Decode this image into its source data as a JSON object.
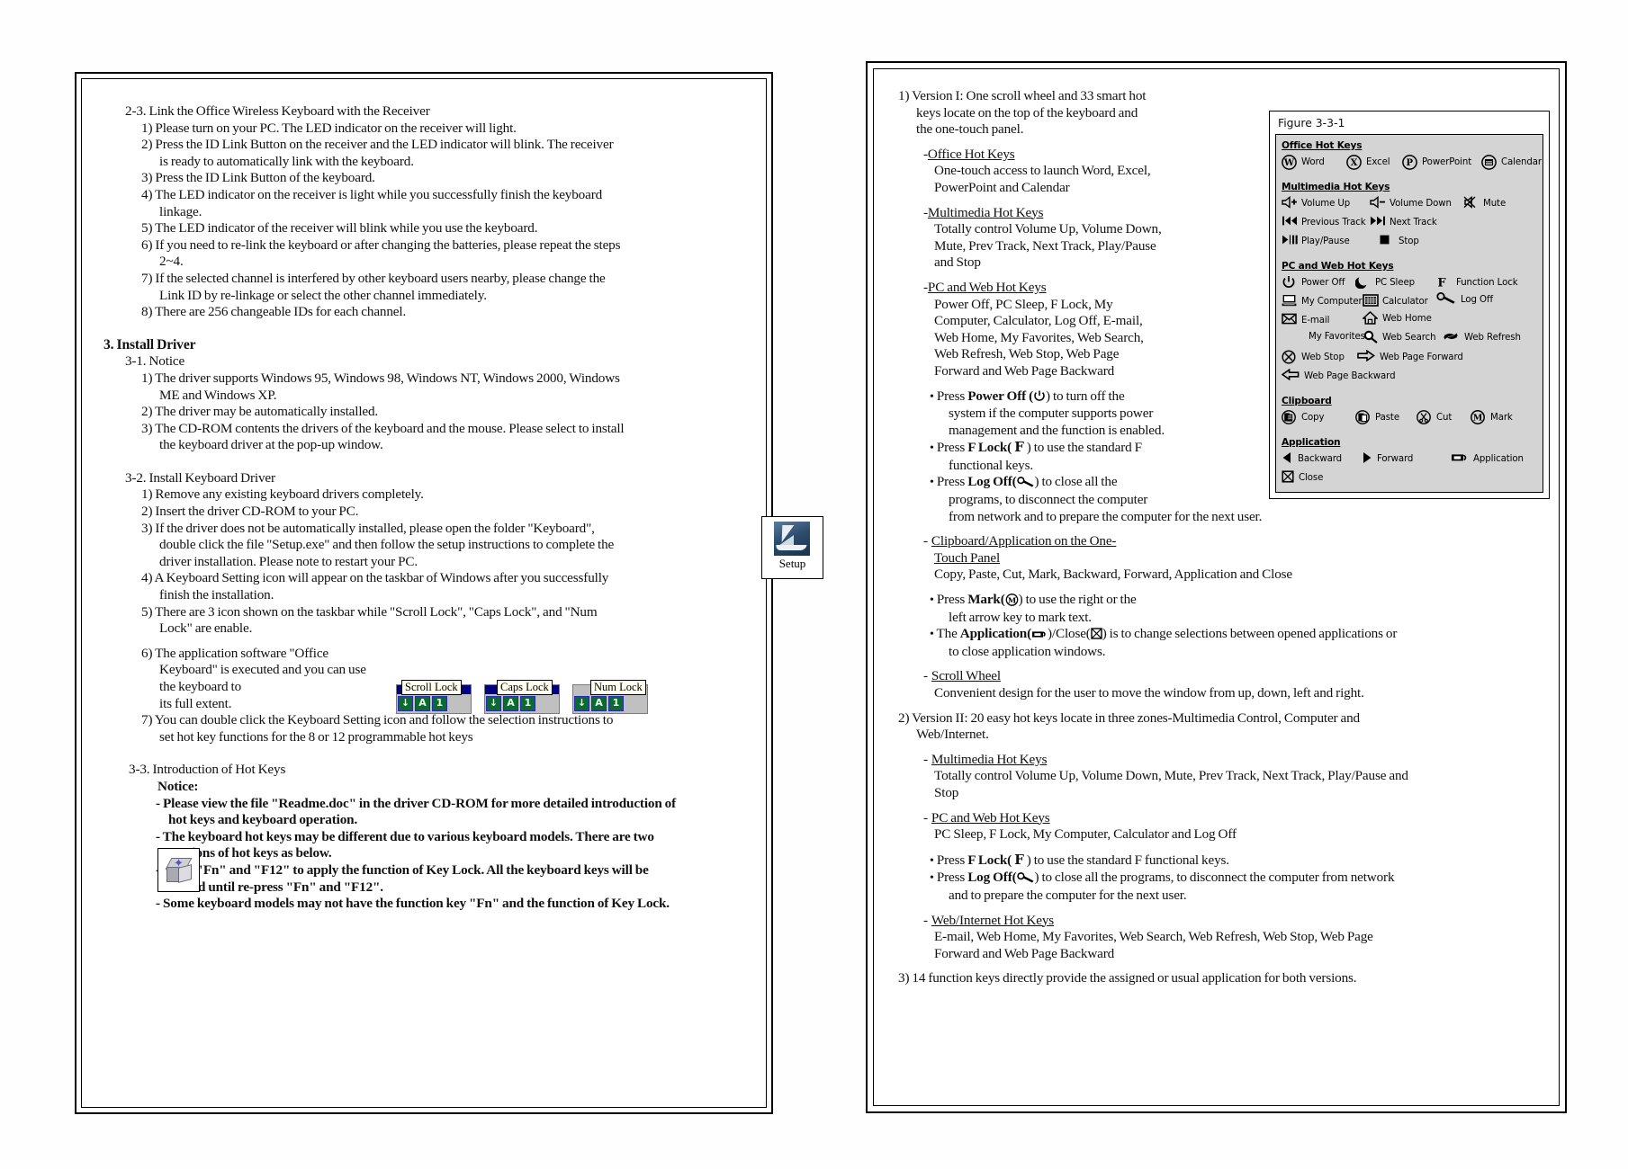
{
  "document": {
    "left_page": {
      "section_2_3": {
        "heading": "2-3. Link the Office Wireless Keyboard with the Receiver",
        "items": [
          "1) Please turn on your PC.  The LED indicator on the receiver will light.",
          "2) Press the ID Link Button on the receiver and the LED indicator will blink.  The receiver is ready to automatically link with the keyboard.",
          "3) Press the ID Link Button of the keyboard.",
          "4) The LED indicator on the receiver is light while you successfully finish the keyboard linkage.",
          "5) The LED indicator of the receiver will blink while you use the keyboard.",
          "6) If you need to re-link the keyboard or after changing the batteries, please repeat the steps 2~4.",
          "7) If the selected channel is interfered by other keyboard users nearby, please change the Link ID by re-linkage or select the other channel immediately.",
          "8) There are 256 changeable IDs for each channel."
        ],
        "item2_line1": "2) Press the ID Link Button on the receiver and the LED indicator will blink.  The receiver",
        "item2_line2": "is ready to automatically link with the keyboard.",
        "item4_line1": "4) The LED indicator on the receiver is light while you successfully finish the keyboard",
        "item4_line2": "linkage.",
        "item6_line1": "6) If you need to re-link the keyboard or after changing the batteries, please repeat the steps",
        "item6_line2": "2~4.",
        "item7_line1": "7) If the selected channel is interfered by other keyboard users nearby, please change the",
        "item7_line2": "Link ID by re-linkage or select the other channel immediately."
      },
      "section_3": {
        "heading": "3. Install Driver",
        "notice": {
          "heading": "3-1. Notice",
          "item1_line1": "1) The driver supports Windows 95, Windows 98, Windows NT, Windows 2000, Windows",
          "item1_line2": "ME and Windows XP.",
          "item2": "2) The driver may be automatically installed.",
          "item3_line1": "3) The CD-ROM contents the drivers of the keyboard and the mouse.  Please select to install",
          "item3_line2": "the keyboard driver at the pop-up window."
        },
        "install_keyboard_driver": {
          "heading": "3-2. Install Keyboard Driver",
          "item1": "1) Remove any existing keyboard drivers completely.",
          "item2": "2) Insert the driver CD-ROM to your PC.",
          "item3_line1": "3) If the driver does not be automatically installed, please open the folder \"Keyboard\",",
          "item3_line2": "double click the file \"Setup.exe\" and then follow the setup instructions to complete the",
          "item3_line3": "driver installation.  Please note to restart your PC.",
          "item4_line1": "4) A Keyboard Setting icon will appear on the taskbar of Windows after you successfully",
          "item4_line2": "finish the installation.",
          "item5_line1": "5) There are 3 icon shown on the taskbar while \"Scroll  Lock\", \"Caps Lock\", and \"Num",
          "item5_line2": "Lock\" are enable.",
          "item6_line1": "6) The application software \"Office",
          "item6_line2": "Keyboard\" is executed and you can use",
          "item6_line3": "the keyboard to",
          "item6_line4": " its full extent.",
          "item7_line1": "7) You can double click the Keyboard Setting icon and follow the selection instructions to",
          "item7_line2": "set hot key functions for the 8 or 12 programmable hot keys"
        },
        "intro_hot_keys": {
          "heading": "3-3. Introduction of Hot Keys",
          "notice_label": "Notice:",
          "notes": [
            "- Please view the file \"Readme.doc\" in the driver CD-ROM for more detailed introduction of",
            "hot keys and keyboard operation.",
            "- The keyboard hot keys may be different due to various keyboard models.  There are two",
            "versions of hot keys as below.",
            "- Press \"Fn\" and \"F12\" to apply the function of Key Lock.  All the keyboard keys will be",
            "locked until re-press \"Fn\" and \"F12\".",
            "- Some keyboard models may not have the function key \"Fn\" and the function of Key Lock."
          ]
        }
      },
      "setup_icon": {
        "label": "Setup"
      },
      "lock_indicators": [
        {
          "tooltip": "Scroll Lock",
          "leds": [
            "↓",
            "A",
            "1"
          ],
          "style": "blue"
        },
        {
          "tooltip": "Caps Lock",
          "leds": [
            "↓",
            "A",
            "1"
          ],
          "style": "blue"
        },
        {
          "tooltip": "Num Lock",
          "leds": [
            "↓",
            "A",
            "1"
          ],
          "style": "gray"
        }
      ]
    },
    "right_page": {
      "version1": {
        "num_line1": "1) Version I: One scroll wheel and 33 smart hot",
        "num_line2": "keys locate on the top of the keyboard and",
        "num_line3": "the one-touch panel.",
        "office": {
          "dash": "-",
          "title": "Office Hot Keys",
          "line1": "One-touch access to launch Word, Excel,",
          "line2": "PowerPoint and Calendar"
        },
        "multimedia": {
          "dash": "-",
          "title": "Multimedia Hot Keys",
          "line1": "Totally control Volume Up, Volume Down,",
          "line2": "Mute, Prev Track, Next Track, Play/Pause",
          "line3": "and Stop"
        },
        "pcweb": {
          "dash": "-",
          "title": "PC and Web Hot Keys",
          "line1": "Power Off, PC Sleep, F Lock, My",
          "line2": "Computer, Calculator, Log Off, E-mail,",
          "line3": "Web Home, My Favorites, Web Search,",
          "line4": "Web Refresh, Web Stop, Web Page",
          "line5": "Forward and Web Page Backward"
        },
        "bullets": {
          "power_pre": "Press ",
          "power_bold": "Power Off (",
          "power_post": ") to turn off the",
          "power_l2": "system if the computer supports power",
          "power_l3": "management and the function is enabled.",
          "flock_pre": "Press ",
          "flock_bold": "F Lock( ",
          "flock_post": " ) to use the standard F",
          "flock_l2": "functional keys.",
          "logoff_pre": "Press ",
          "logoff_bold": "Log Off(",
          "logoff_post": ") to close all the",
          "logoff_l2": "programs, to disconnect the computer",
          "logoff_l3": "from network and to prepare the computer for the next user."
        },
        "clipboard": {
          "dash": "-",
          "title_l1": "Clipboard/Application on the One-",
          "title_l2": "Touch Panel",
          "line1": "Copy, Paste, Cut, Mark, Backward, Forward, Application and Close",
          "mark_pre": "Press ",
          "mark_bold": "Mark(",
          "mark_post": ") to use the right or the",
          "mark_l2": "left arrow key to mark text.",
          "app_pre": "The ",
          "app_bold": "Application(",
          "app_mid": ")/Close(",
          "app_post": ") is to change selections between opened applications or",
          "app_l2": "to close application windows."
        },
        "scroll": {
          "dash": "-",
          "title": "Scroll Wheel",
          "line1": "Convenient design for the user to move the window from up, down, left and right."
        }
      },
      "version2": {
        "num_line1": "2) Version II: 20 easy hot keys locate in three zones-Multimedia Control, Computer and",
        "num_line2": "Web/Internet.",
        "multimedia": {
          "dash": "-",
          "title": "Multimedia Hot Keys",
          "line1": "Totally control Volume Up, Volume Down, Mute, Prev Track, Next Track, Play/Pause and",
          "line2": "Stop"
        },
        "pcweb": {
          "dash": "-",
          "title": "PC and Web Hot Keys",
          "line1": "PC Sleep, F Lock, My Computer, Calculator and Log Off"
        },
        "bullets": {
          "flock_pre": "Press ",
          "flock_bold": "F Lock( ",
          "flock_post": " ) to use the standard F functional keys.",
          "logoff_pre": "Press ",
          "logoff_bold": "Log Off(",
          "logoff_post": ") to close all the programs, to disconnect the computer from network",
          "logoff_l2": "and to prepare the computer for the next user."
        },
        "webinternet": {
          "dash": "-",
          "title": "Web/Internet Hot Keys",
          "line1": "E-mail, Web Home, My Favorites, Web Search, Web Refresh, Web Stop, Web Page",
          "line2": "Forward and Web Page Backward"
        }
      },
      "version3_note": "3) 14 function keys directly provide the assigned or usual application for both versions.",
      "figure": {
        "caption": "Figure 3-3-1",
        "sections": {
          "office": {
            "title": "Office Hot Keys",
            "items": [
              {
                "icon": "word-icon",
                "label": "Word"
              },
              {
                "icon": "excel-icon",
                "label": "Excel"
              },
              {
                "icon": "powerpoint-icon",
                "label": "PowerPoint"
              },
              {
                "icon": "calendar-icon",
                "label": "Calendar"
              }
            ]
          },
          "multimedia": {
            "title": "Multimedia  Hot Keys",
            "items": [
              {
                "icon": "volume-up-icon",
                "label": "Volume Up"
              },
              {
                "icon": "volume-down-icon",
                "label": "Volume Down"
              },
              {
                "icon": "mute-icon",
                "label": "Mute"
              },
              {
                "icon": "previous-track-icon",
                "label": "Previous  Track"
              },
              {
                "icon": "next-track-icon",
                "label": "Next Track"
              },
              {
                "icon": "play-pause-icon",
                "label": "Play/Pause"
              },
              {
                "icon": "stop-icon",
                "label": "Stop"
              }
            ]
          },
          "pcweb": {
            "title": "PC and Web Hot Keys",
            "items": [
              {
                "icon": "power-off-icon",
                "label": "Power Off"
              },
              {
                "icon": "pc-sleep-icon",
                "label": "PC Sleep"
              },
              {
                "icon": "function-lock-icon",
                "label": "Function  Lock"
              },
              {
                "icon": "my-computer-icon",
                "label": "My Computer"
              },
              {
                "icon": "calculator-icon",
                "label": "Calculator"
              },
              {
                "icon": "log-off-icon",
                "label": "Log Off"
              },
              {
                "icon": "email-icon",
                "label": "E-mail"
              },
              {
                "icon": "web-home-icon",
                "label": "Web Home"
              },
              {
                "icon": "my-favorites-icon",
                "label": "My Favorites"
              },
              {
                "icon": "web-search-icon",
                "label": "Web Search"
              },
              {
                "icon": "web-refresh-icon",
                "label": "Web Refresh"
              },
              {
                "icon": "web-stop-icon",
                "label": "Web Stop"
              },
              {
                "icon": "web-page-forward-icon",
                "label": "Web Page Forward"
              },
              {
                "icon": "web-page-backward-icon",
                "label": "Web Page Backward"
              }
            ]
          },
          "clipboard": {
            "title": "Clipboard",
            "items": [
              {
                "icon": "copy-icon",
                "label": "Copy"
              },
              {
                "icon": "paste-icon",
                "label": "Paste"
              },
              {
                "icon": "cut-icon",
                "label": "Cut"
              },
              {
                "icon": "mark-icon",
                "label": "Mark"
              }
            ]
          },
          "application": {
            "title": "Application",
            "items": [
              {
                "icon": "backward-icon",
                "label": "Backward"
              },
              {
                "icon": "forward-icon",
                "label": "Forward"
              },
              {
                "icon": "application-icon",
                "label": "Application"
              },
              {
                "icon": "close-icon",
                "label": "Close"
              }
            ]
          }
        }
      }
    }
  },
  "colors": {
    "page_background": "#ffffff",
    "figure_fill": "#d4d4d4",
    "titlebar_blue": "#000080",
    "led_green": "#0a6b2e",
    "tooltip_bg": "#fffff0"
  }
}
